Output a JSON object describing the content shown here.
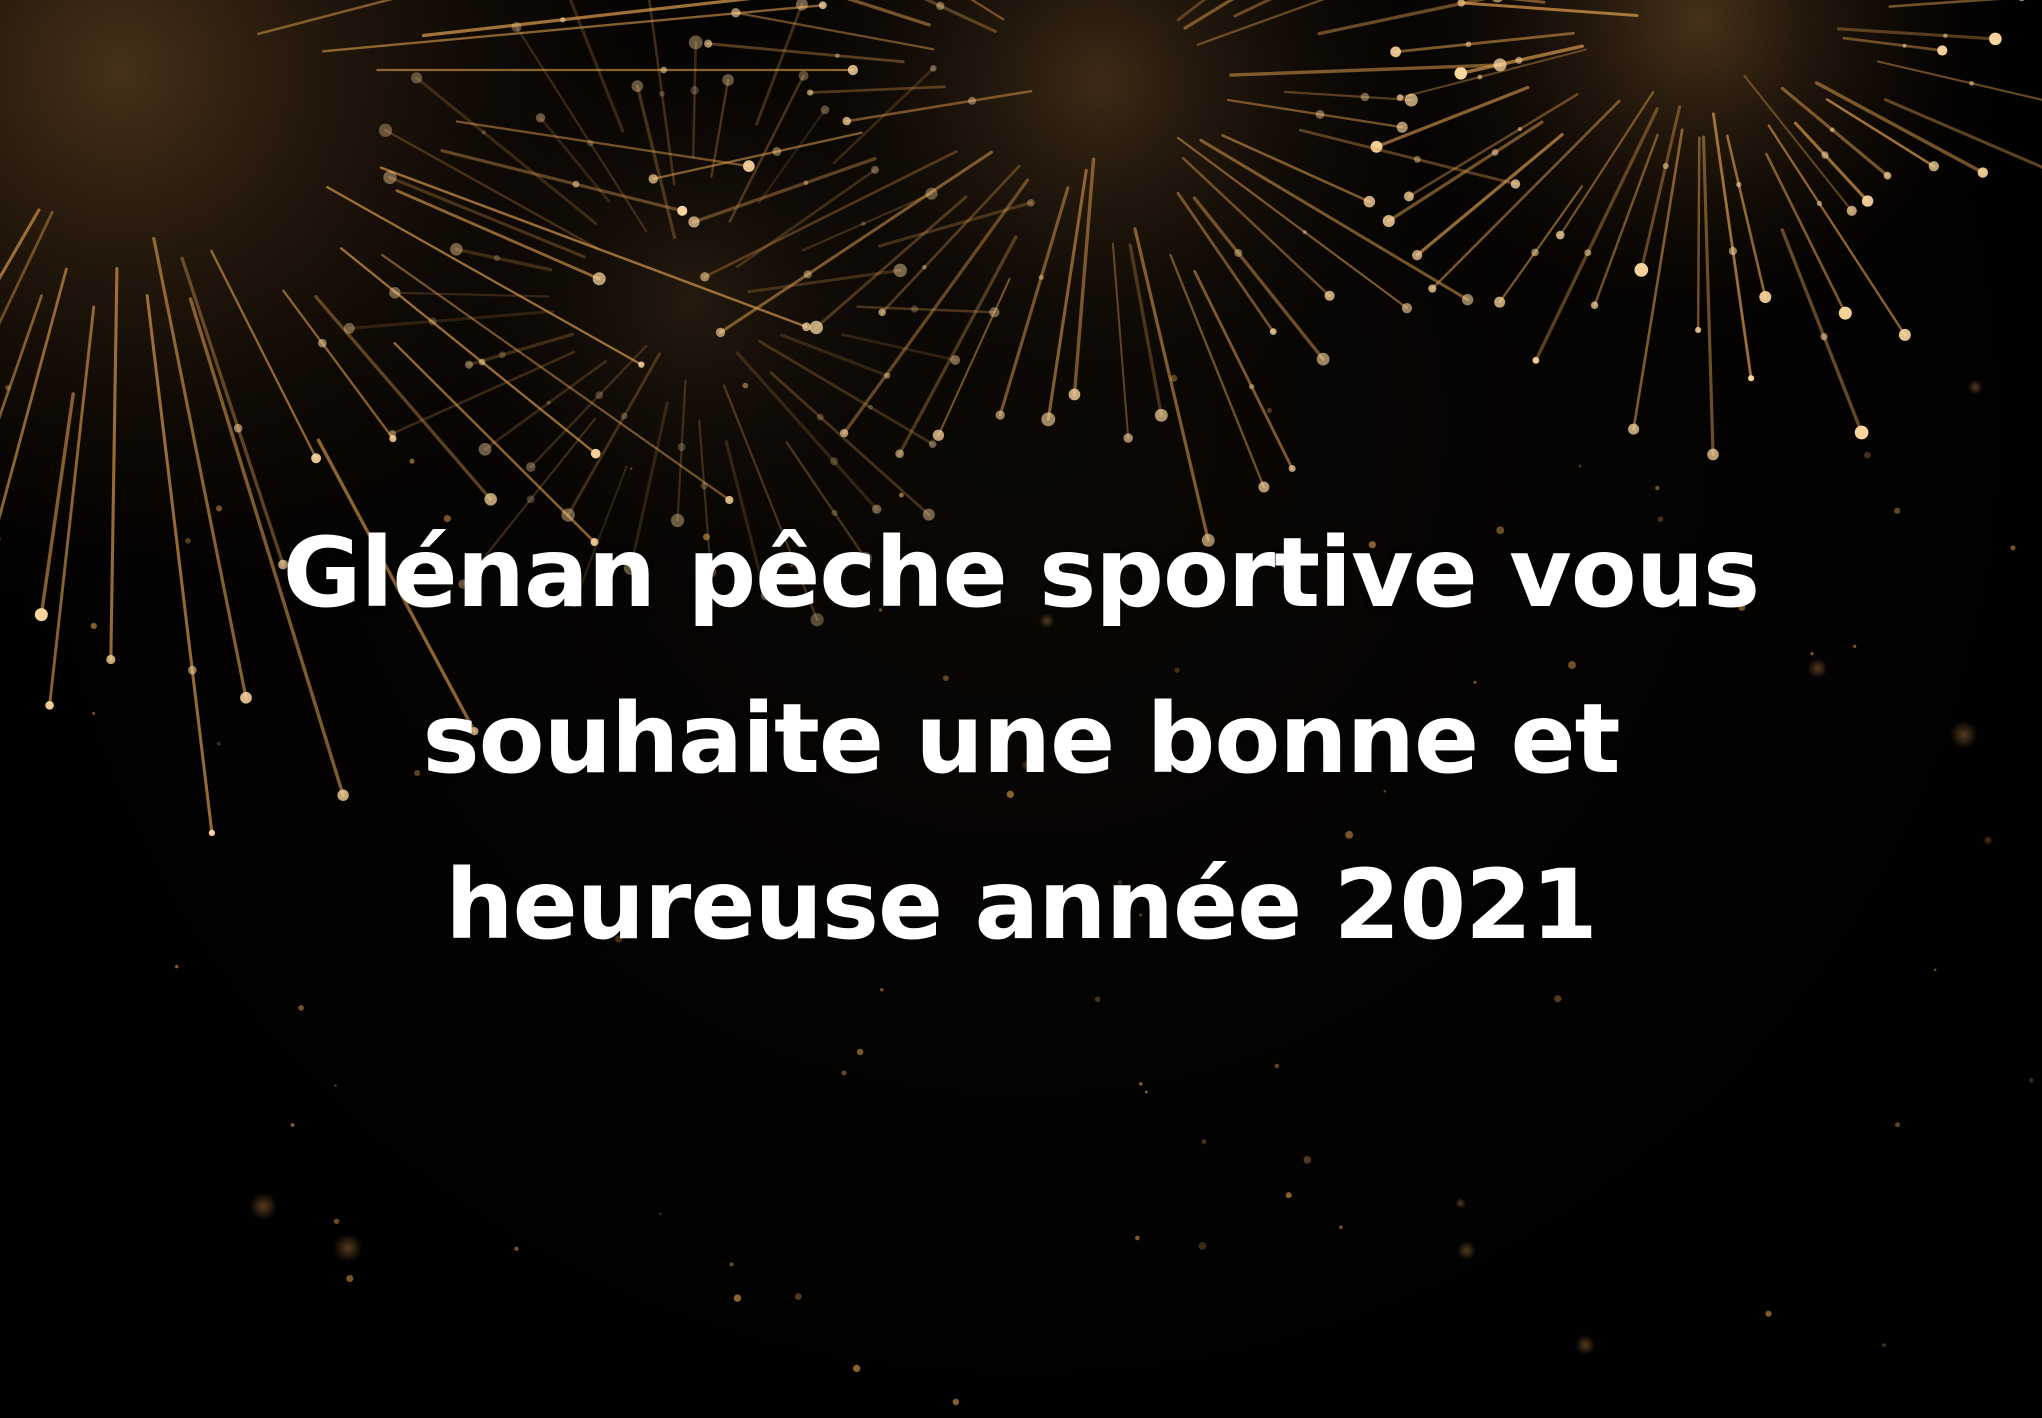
{
  "greeting": {
    "lines": [
      "Glénan pêche sportive vous",
      "souhaite une bonne et",
      "heureuse année 2021"
    ]
  },
  "colors": {
    "background": "#000000",
    "spark": "#ffd9a0",
    "spark_glow": "#e0a050",
    "text": "#ffffff"
  }
}
